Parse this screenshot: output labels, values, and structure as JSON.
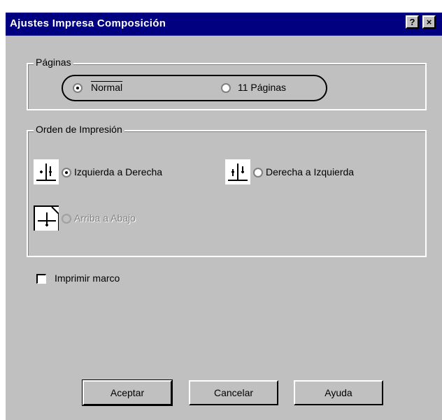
{
  "window": {
    "title": "Ajustes Impresa Composición",
    "help_button": "?",
    "close_button": "×"
  },
  "paginas_group": {
    "label": "Páginas",
    "options": [
      {
        "label": "Normal",
        "selected": true
      },
      {
        "label": "11 Páginas",
        "selected": false
      }
    ]
  },
  "orden_group": {
    "label": "Orden de Impresión",
    "options": [
      {
        "label": "Izquierda a Derecha",
        "selected": true,
        "disabled": false
      },
      {
        "label": "Derecha a Izquierda",
        "selected": false,
        "disabled": false
      },
      {
        "label": "Arriba a Abajo",
        "selected": false,
        "disabled": true
      }
    ]
  },
  "imprimir_marco": {
    "label": "Imprimir marco",
    "checked": false
  },
  "buttons": {
    "accept": "Aceptar",
    "cancel": "Cancelar",
    "help": "Ayuda"
  },
  "icon_names": [
    "left-to-right-icon",
    "right-to-left-icon",
    "top-to-bottom-icon"
  ]
}
